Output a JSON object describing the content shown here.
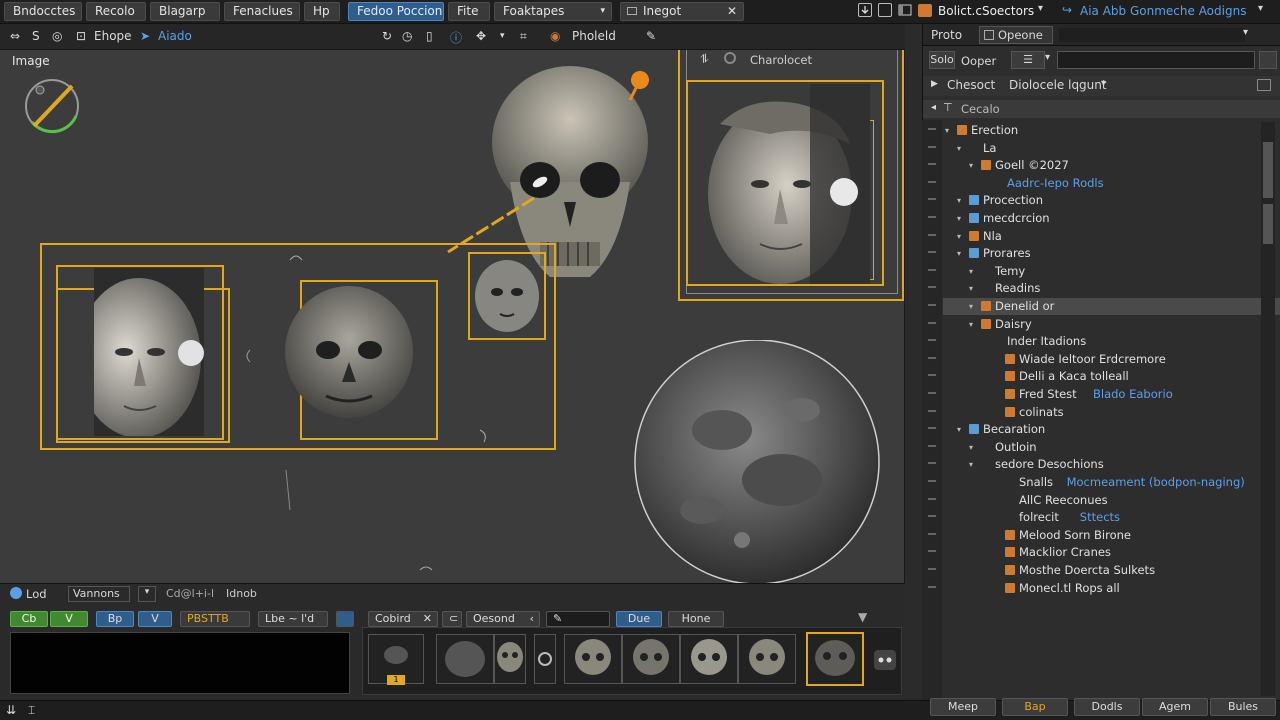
{
  "menubar": {
    "tabs": [
      "Bndocctes",
      "Recolo",
      "Blagarp",
      "Fenaclues",
      "Hp",
      "Fedoo Poccion",
      "Fite",
      "Foaktapes",
      "Inegot"
    ],
    "right_title": "Bolict.cSoectors",
    "right_link": "Aia Abb Gonmeche Aodigns"
  },
  "toolbar": {
    "item1": "Ehope",
    "item2": "Aiado",
    "item3": "Pholeld"
  },
  "viewport": {
    "label": "Image",
    "panel_label": "Charolocet"
  },
  "bottom": {
    "tabs": {
      "lod": "Lod",
      "vannons": "Vannons",
      "field1": "Cd@l+i-l",
      "field2": "Idnob"
    },
    "row1": {
      "btn1": "Cb",
      "btn2": "V",
      "btn3": "Bp",
      "btn4": "V",
      "label1": "PBSTTB",
      "field": "Lbe ~ l'd",
      "cobird": "Cobird",
      "oesond": "Oesond",
      "due": "Due",
      "hone": "Hone"
    },
    "thumb_badge": "1"
  },
  "rpanel": {
    "tabs": {
      "proto": "Proto",
      "opeone": "Opeone"
    },
    "row2": {
      "solo": "Solo",
      "oopoer": "Ooper"
    },
    "row3": {
      "chesect": "Chesoct",
      "layout": "Diolocele lqgunt"
    },
    "row4": "Cecalo",
    "tree": [
      {
        "label": "Erection",
        "indent": 0,
        "icon": "#d07a30"
      },
      {
        "label": "La",
        "indent": 1,
        "icon": ""
      },
      {
        "label": "Goell ©2027",
        "indent": 2,
        "icon": "#d07a30"
      },
      {
        "label": "Aadrc-Iepo Rodls",
        "indent": 3,
        "icon": "",
        "blue": true
      },
      {
        "label": "Procection",
        "indent": 1,
        "icon": "#5a9bd8"
      },
      {
        "label": "mecdcrcion",
        "indent": 1,
        "icon": "#5a9bd8"
      },
      {
        "label": "Nla",
        "indent": 1,
        "icon": "#d07a30"
      },
      {
        "label": "Prorares",
        "indent": 1,
        "icon": "#5a9bd8"
      },
      {
        "label": "Temy",
        "indent": 2,
        "icon": ""
      },
      {
        "label": "Readins",
        "indent": 2,
        "icon": ""
      },
      {
        "label": "Denelid or",
        "indent": 2,
        "icon": "#d07a30",
        "hl": true
      },
      {
        "label": "Daisry",
        "indent": 2,
        "icon": "#d07a30"
      },
      {
        "label": "Inder Itadions",
        "indent": 3,
        "icon": ""
      },
      {
        "label": "Wiade Ieltoor Erdcremore",
        "indent": 4,
        "icon": "#d07a30"
      },
      {
        "label": "Delli a Kaca tolleall",
        "indent": 4,
        "icon": "#d07a30"
      },
      {
        "label": "Fred Stest",
        "indent": 4,
        "icon": "#d07a30",
        "extra": "Blado Eaborio"
      },
      {
        "label": "colinats",
        "indent": 4,
        "icon": "#d07a30"
      },
      {
        "label": "Becaration",
        "indent": 1,
        "icon": "#5a9bd8"
      },
      {
        "label": "Outloin",
        "indent": 2,
        "icon": ""
      },
      {
        "label": "sedore Desochions",
        "indent": 2,
        "icon": ""
      },
      {
        "label": "Snalls",
        "indent": 4,
        "icon": "",
        "extra": "Mocmeament (bodpon-naging)"
      },
      {
        "label": "AllC Reeconues",
        "indent": 4,
        "icon": ""
      },
      {
        "label": "folrecit",
        "indent": 4,
        "icon": "",
        "extra": "Sttects"
      },
      {
        "label": "Melood Sorn Birone",
        "indent": 4,
        "icon": "#d07a30"
      },
      {
        "label": "Macklior Cranes",
        "indent": 4,
        "icon": "#d07a30"
      },
      {
        "label": "Mosthe Doercta Sulkets",
        "indent": 4,
        "icon": "#d07a30"
      },
      {
        "label": "Monecl.tl Rops all",
        "indent": 4,
        "icon": "#d07a30"
      }
    ],
    "bottom_buttons": [
      "Meep",
      "Bap",
      "Dodls",
      "Agem",
      "Bules"
    ]
  },
  "colors": {
    "accent": "#e0a81c",
    "selection": "#2f5d8c",
    "orange_icon": "#d07a30",
    "blue_icon": "#5a9bd8"
  }
}
